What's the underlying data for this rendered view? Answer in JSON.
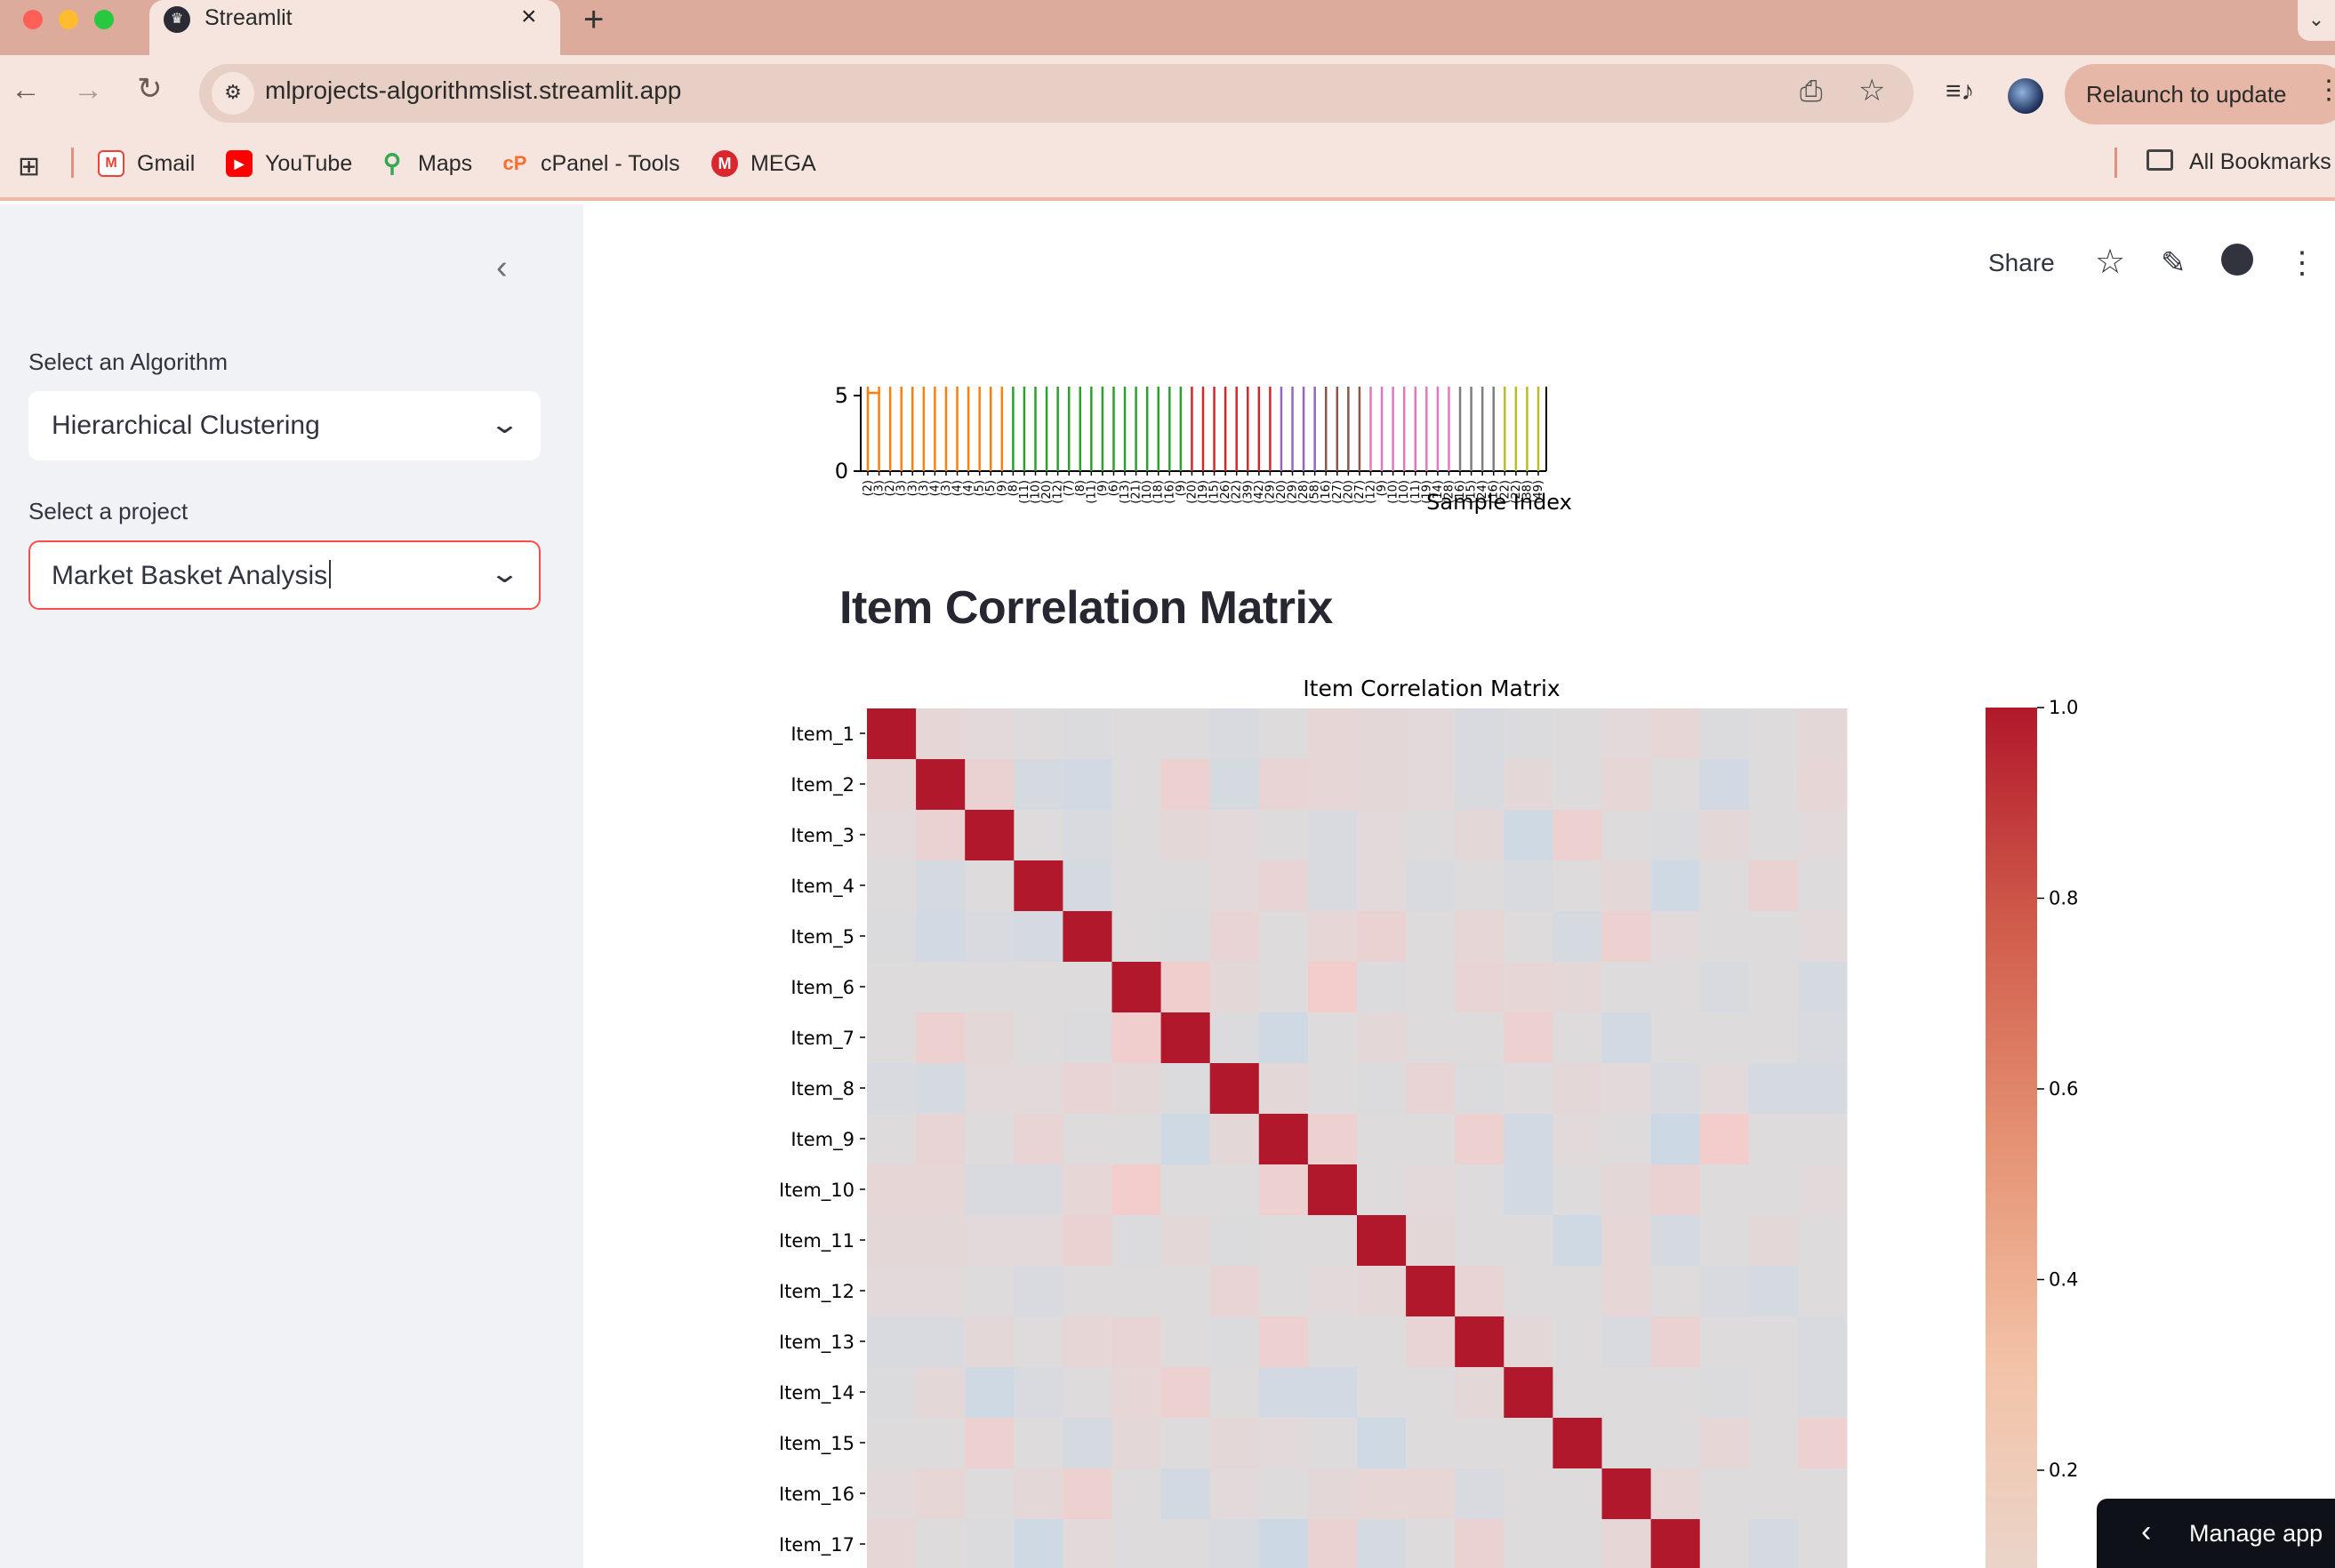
{
  "browser": {
    "tab_title": "Streamlit",
    "url": "mlprojects-algorithmslist.streamlit.app",
    "relaunch_label": "Relaunch to update",
    "bookmarks": [
      {
        "label": "Gmail",
        "icon": "gmail-icon",
        "color": "#ea4335"
      },
      {
        "label": "YouTube",
        "icon": "youtube-icon",
        "color": "#ff0000"
      },
      {
        "label": "Maps",
        "icon": "maps-icon",
        "color": "#34a853"
      },
      {
        "label": "cPanel - Tools",
        "icon": "cpanel-icon",
        "color": "#ff6c2c"
      },
      {
        "label": "MEGA",
        "icon": "mega-icon",
        "color": "#d9272e"
      }
    ],
    "all_bookmarks_label": "All Bookmarks"
  },
  "sidebar": {
    "algorithm_label": "Select an Algorithm",
    "algorithm_value": "Hierarchical Clustering",
    "project_label": "Select a project",
    "project_value": "Market Basket Analysis"
  },
  "header": {
    "share_label": "Share"
  },
  "main": {
    "section_title": "Item Correlation Matrix"
  },
  "manage_app_label": "Manage app",
  "chart_data": [
    {
      "type": "dendrogram",
      "xlabel": "Sample Index",
      "ylim": [
        0,
        5.5
      ],
      "yticks": [
        0,
        5
      ],
      "leaf_labels": [
        "(2)",
        "(3)",
        "(2)",
        "(3)",
        "(3)",
        "(3)",
        "(4)",
        "(3)",
        "(4)",
        "(4)",
        "(5)",
        "(5)",
        "(9)",
        "(8)",
        "(11)",
        "(10)",
        "(20)",
        "(12)",
        "(7)",
        "(8)",
        "(11)",
        "(9)",
        "(6)",
        "(13)",
        "(21)",
        "(10)",
        "(18)",
        "(16)",
        "(9)",
        "(20)",
        "(19)",
        "(15)",
        "(26)",
        "(22)",
        "(39)",
        "(42)",
        "(29)",
        "(20)",
        "(29)",
        "(28)",
        "(58)",
        "(16)",
        "(27)",
        "(20)",
        "(27)",
        "(12)",
        "(9)",
        "(10)",
        "(10)",
        "(11)",
        "(19)",
        "(14)",
        "(28)",
        "(16)",
        "(15)",
        "(24)",
        "(16)",
        "(22)",
        "(22)",
        "(38)",
        "(49)"
      ],
      "cluster_colors": [
        "#ff7f0e",
        "#ff7f0e",
        "#ff7f0e",
        "#ff7f0e",
        "#ff7f0e",
        "#ff7f0e",
        "#ff7f0e",
        "#ff7f0e",
        "#ff7f0e",
        "#ff7f0e",
        "#ff7f0e",
        "#ff7f0e",
        "#ff7f0e",
        "#2ca02c",
        "#2ca02c",
        "#2ca02c",
        "#2ca02c",
        "#2ca02c",
        "#2ca02c",
        "#2ca02c",
        "#2ca02c",
        "#2ca02c",
        "#2ca02c",
        "#2ca02c",
        "#2ca02c",
        "#2ca02c",
        "#2ca02c",
        "#2ca02c",
        "#2ca02c",
        "#d62728",
        "#d62728",
        "#d62728",
        "#d62728",
        "#d62728",
        "#d62728",
        "#d62728",
        "#d62728",
        "#9467bd",
        "#9467bd",
        "#9467bd",
        "#9467bd",
        "#8c564b",
        "#8c564b",
        "#8c564b",
        "#8c564b",
        "#e377c2",
        "#e377c2",
        "#e377c2",
        "#e377c2",
        "#e377c2",
        "#e377c2",
        "#e377c2",
        "#e377c2",
        "#7f7f7f",
        "#7f7f7f",
        "#7f7f7f",
        "#7f7f7f",
        "#bcbd22",
        "#bcbd22",
        "#bcbd22",
        "#bcbd22"
      ]
    },
    {
      "type": "heatmap",
      "title": "Item Correlation Matrix",
      "rows": [
        "Item_1",
        "Item_2",
        "Item_3",
        "Item_4",
        "Item_5",
        "Item_6",
        "Item_7",
        "Item_8",
        "Item_9",
        "Item_10",
        "Item_11",
        "Item_12",
        "Item_13",
        "Item_14",
        "Item_15",
        "Item_16",
        "Item_17"
      ],
      "total_columns": 20,
      "colorbar_ticks": [
        "1.0",
        "0.8",
        "0.6",
        "0.4",
        "0.2"
      ],
      "colorbar_range": [
        0,
        1.0
      ],
      "diagonal_value": 1.0,
      "off_diagonal_values": [
        [
          1,
          0.03,
          0.01,
          0,
          -0.01,
          0,
          0,
          -0.02,
          0,
          0.03,
          0.02,
          0.01,
          -0.02,
          -0.01,
          0,
          0.01,
          0.03,
          -0.01,
          0,
          0.02
        ],
        [
          0.03,
          1,
          0.05,
          -0.03,
          -0.04,
          0,
          0.06,
          -0.03,
          0.04,
          0.03,
          0.02,
          0.01,
          -0.02,
          0.02,
          0,
          0.03,
          0,
          -0.04,
          0,
          0.03
        ],
        [
          0.01,
          0.05,
          1,
          0,
          -0.02,
          0,
          0.02,
          0.01,
          0,
          -0.02,
          0.01,
          0,
          0.02,
          -0.05,
          0.06,
          0,
          -0.01,
          0.02,
          0,
          0.01
        ],
        [
          0,
          -0.03,
          0,
          1,
          -0.03,
          0,
          0,
          0.01,
          0.04,
          -0.02,
          0.01,
          -0.02,
          0,
          -0.02,
          0,
          0.02,
          -0.05,
          0,
          0.05,
          0
        ],
        [
          -0.01,
          -0.04,
          -0.02,
          -0.03,
          1,
          0,
          -0.01,
          0.04,
          0,
          0.03,
          0.05,
          0,
          0.03,
          0,
          -0.03,
          0.06,
          0.01,
          0,
          0,
          0.01
        ],
        [
          0,
          0,
          0,
          0,
          0,
          1,
          0.07,
          0.02,
          0,
          0.08,
          -0.01,
          0,
          0.04,
          0.03,
          0.02,
          0,
          0,
          -0.02,
          0,
          -0.03
        ],
        [
          0,
          0.06,
          0.02,
          0,
          -0.01,
          0.07,
          1,
          -0.01,
          -0.05,
          0,
          0.02,
          0,
          0,
          0.06,
          0,
          -0.04,
          0,
          0,
          0,
          -0.02
        ],
        [
          -0.02,
          -0.03,
          0.01,
          0.01,
          0.04,
          0.02,
          -0.01,
          1,
          0.02,
          0,
          -0.01,
          0.04,
          -0.01,
          0,
          0.02,
          0.01,
          -0.02,
          0.01,
          -0.03,
          -0.03
        ],
        [
          0,
          0.04,
          0,
          0.04,
          0,
          0,
          -0.05,
          0.02,
          1,
          0.06,
          0,
          0,
          0.06,
          -0.04,
          0.01,
          0,
          -0.06,
          0.08,
          0,
          0
        ],
        [
          0.03,
          0.03,
          -0.02,
          -0.02,
          0.03,
          0.08,
          0,
          0,
          0.06,
          1,
          0,
          0.01,
          0,
          -0.04,
          0,
          0.02,
          0.05,
          0,
          0,
          0.01
        ],
        [
          0.02,
          0.02,
          0.01,
          0.01,
          0.05,
          -0.01,
          0.02,
          -0.01,
          0,
          0,
          1,
          0.02,
          0,
          0,
          -0.05,
          0.03,
          -0.03,
          0,
          0.02,
          0
        ],
        [
          0.01,
          0.01,
          0,
          -0.02,
          0,
          0,
          0,
          0.04,
          0,
          0.01,
          0.02,
          1,
          0.04,
          0,
          0,
          0.03,
          0,
          -0.02,
          -0.03,
          0
        ],
        [
          -0.02,
          -0.02,
          0.02,
          0,
          0.03,
          0.04,
          0,
          -0.01,
          0.06,
          0,
          0,
          0.04,
          1,
          0.02,
          0,
          -0.02,
          0.05,
          0,
          0,
          -0.02
        ],
        [
          -0.01,
          0.02,
          -0.05,
          -0.02,
          0,
          0.03,
          0.06,
          0,
          -0.04,
          -0.04,
          0,
          0,
          0.02,
          1,
          0,
          0,
          0,
          -0.01,
          0,
          -0.02
        ],
        [
          0,
          0,
          0.06,
          0,
          -0.03,
          0.02,
          0,
          0.02,
          0.01,
          0,
          -0.05,
          0,
          0,
          0,
          1,
          0,
          0,
          0.03,
          0,
          0.06
        ],
        [
          0.01,
          0.03,
          0,
          0.02,
          0.06,
          0,
          -0.04,
          0.01,
          0,
          0.02,
          0.03,
          0.03,
          -0.02,
          0,
          0,
          1,
          0.03,
          0,
          0,
          0
        ],
        [
          0.03,
          0,
          -0.01,
          -0.05,
          0.01,
          0,
          0,
          -0.02,
          -0.06,
          0.05,
          -0.03,
          0,
          0.05,
          0,
          0,
          0.03,
          1,
          0,
          -0.03,
          0
        ]
      ]
    }
  ]
}
